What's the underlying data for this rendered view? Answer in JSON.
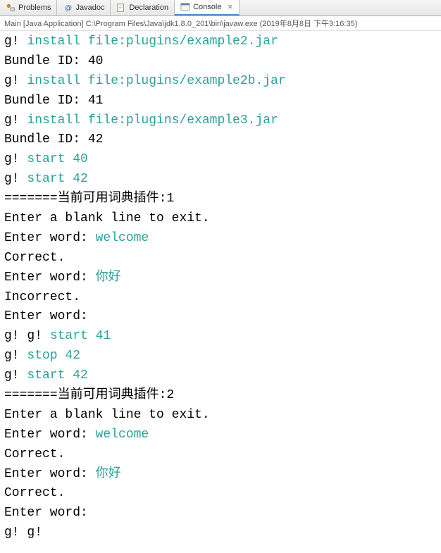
{
  "tabs": [
    {
      "label": "Problems"
    },
    {
      "label": "Javadoc"
    },
    {
      "label": "Declaration"
    },
    {
      "label": "Console"
    }
  ],
  "subheader": "Main [Java Application] C:\\Program Files\\Java\\jdk1.8.0_201\\bin\\javaw.exe (2019年8月8日 下午3:16:35)",
  "lines": [
    [
      {
        "t": "g! ",
        "c": null
      },
      {
        "t": "install file:plugins/example2.jar",
        "c": "teal"
      }
    ],
    [
      {
        "t": "Bundle ID: 40",
        "c": null
      }
    ],
    [
      {
        "t": "g! ",
        "c": null
      },
      {
        "t": "install file:plugins/example2b.jar",
        "c": "teal"
      }
    ],
    [
      {
        "t": "Bundle ID: 41",
        "c": null
      }
    ],
    [
      {
        "t": "g! ",
        "c": null
      },
      {
        "t": "install file:plugins/example3.jar",
        "c": "teal"
      }
    ],
    [
      {
        "t": "Bundle ID: 42",
        "c": null
      }
    ],
    [
      {
        "t": "g! ",
        "c": null
      },
      {
        "t": "start 40",
        "c": "teal"
      }
    ],
    [
      {
        "t": "g! ",
        "c": null
      },
      {
        "t": "start 42",
        "c": "teal"
      }
    ],
    [
      {
        "t": "=======当前可用词典插件:1",
        "c": null
      }
    ],
    [
      {
        "t": "Enter a blank line to exit.",
        "c": null
      }
    ],
    [
      {
        "t": "Enter word: ",
        "c": null
      },
      {
        "t": "welcome",
        "c": "teal"
      }
    ],
    [
      {
        "t": "Correct.",
        "c": null
      }
    ],
    [
      {
        "t": "Enter word: ",
        "c": null
      },
      {
        "t": "你好",
        "c": "teal"
      }
    ],
    [
      {
        "t": "Incorrect.",
        "c": null
      }
    ],
    [
      {
        "t": "Enter word: ",
        "c": null
      }
    ],
    [
      {
        "t": "g! g! ",
        "c": null
      },
      {
        "t": "start 41",
        "c": "teal"
      }
    ],
    [
      {
        "t": "g! ",
        "c": null
      },
      {
        "t": "stop 42",
        "c": "teal"
      }
    ],
    [
      {
        "t": "g! ",
        "c": null
      },
      {
        "t": "start 42",
        "c": "teal"
      }
    ],
    [
      {
        "t": "=======当前可用词典插件:2",
        "c": null
      }
    ],
    [
      {
        "t": "Enter a blank line to exit.",
        "c": null
      }
    ],
    [
      {
        "t": "Enter word: ",
        "c": null
      },
      {
        "t": "welcome",
        "c": "teal"
      }
    ],
    [
      {
        "t": "Correct.",
        "c": null
      }
    ],
    [
      {
        "t": "Enter word: ",
        "c": null
      },
      {
        "t": "你好",
        "c": "teal"
      }
    ],
    [
      {
        "t": "Correct.",
        "c": null
      }
    ],
    [
      {
        "t": "Enter word: ",
        "c": null
      }
    ],
    [
      {
        "t": "g! g! ",
        "c": null
      }
    ]
  ]
}
